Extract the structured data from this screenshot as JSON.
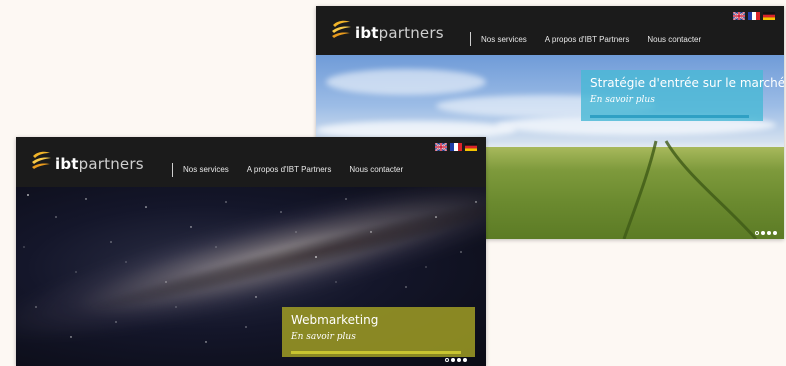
{
  "brand": {
    "name_bold": "ibt",
    "name_light": "partners",
    "swoosh_color": "#f0b429"
  },
  "nav": {
    "items": [
      "Nos services",
      "A propos d'IBT Partners",
      "Nous contacter"
    ]
  },
  "languages": [
    "English",
    "Français",
    "Deutsch"
  ],
  "screens": [
    {
      "slide": "wheat-field",
      "caption": {
        "title": "Stratégie d'entrée sur le marché",
        "link": "En savoir plus",
        "color": "#49b8d6"
      },
      "slider_position": 1,
      "slider_total": 4
    },
    {
      "slide": "milky-way",
      "caption": {
        "title": "Webmarketing",
        "link": "En savoir plus",
        "color": "#a09e24"
      },
      "slider_position": 1,
      "slider_total": 4
    }
  ],
  "colors": {
    "header": "#1b1b1b",
    "page_background": "#fdf8f3"
  }
}
